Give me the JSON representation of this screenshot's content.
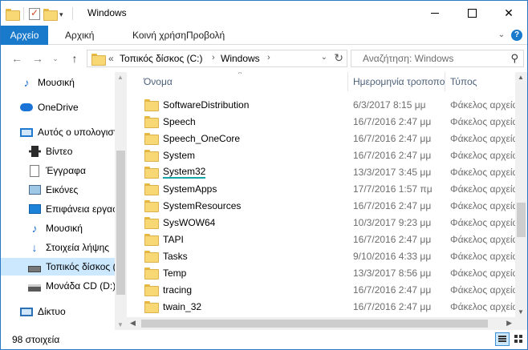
{
  "window": {
    "title": "Windows"
  },
  "ribbon": {
    "file_tab": "Αρχείο",
    "tabs": [
      "Αρχική",
      "Κοινή χρήση",
      "Προβολή"
    ]
  },
  "address": {
    "overflow": "«",
    "crumbs": [
      "Τοπικός δίσκος (C:)",
      "Windows"
    ]
  },
  "search": {
    "placeholder": "Αναζήτηση: Windows"
  },
  "nav": {
    "items": [
      {
        "label": "Μουσική",
        "icon": "music-note-icon"
      },
      {
        "label": "OneDrive",
        "icon": "cloud-icon"
      },
      {
        "label": "Αυτός ο υπολογιστής",
        "icon": "computer-icon"
      },
      {
        "label": "Βίντεο",
        "icon": "video-icon"
      },
      {
        "label": "Έγγραφα",
        "icon": "documents-icon"
      },
      {
        "label": "Εικόνες",
        "icon": "pictures-icon"
      },
      {
        "label": "Επιφάνεια εργασίας",
        "icon": "desktop-icon"
      },
      {
        "label": "Μουσική",
        "icon": "music-note-icon"
      },
      {
        "label": "Στοιχεία λήψης",
        "icon": "download-arrow-icon"
      },
      {
        "label": "Τοπικός δίσκος (C:)",
        "icon": "local-disk-icon"
      },
      {
        "label": "Μονάδα CD (D:)",
        "icon": "cd-drive-icon"
      },
      {
        "label": "Δίκτυο",
        "icon": "network-icon"
      }
    ]
  },
  "columns": {
    "name": "Όνομα",
    "date": "Ημερομηνία τροποποίησης",
    "type": "Τύπος"
  },
  "files": [
    {
      "name": "SoftwareDistribution",
      "date": "6/3/2017 8:15 μμ",
      "type": "Φάκελος αρχείων"
    },
    {
      "name": "Speech",
      "date": "16/7/2016 2:47 μμ",
      "type": "Φάκελος αρχείων"
    },
    {
      "name": "Speech_OneCore",
      "date": "16/7/2016 2:47 μμ",
      "type": "Φάκελος αρχείων"
    },
    {
      "name": "System",
      "date": "16/7/2016 2:47 μμ",
      "type": "Φάκελος αρχείων"
    },
    {
      "name": "System32",
      "date": "13/3/2017 3:45 μμ",
      "type": "Φάκελος αρχείων"
    },
    {
      "name": "SystemApps",
      "date": "17/7/2016 1:57 πμ",
      "type": "Φάκελος αρχείων"
    },
    {
      "name": "SystemResources",
      "date": "16/7/2016 2:47 μμ",
      "type": "Φάκελος αρχείων"
    },
    {
      "name": "SysWOW64",
      "date": "10/3/2017 9:23 μμ",
      "type": "Φάκελος αρχείων"
    },
    {
      "name": "TAPI",
      "date": "16/7/2016 2:47 μμ",
      "type": "Φάκελος αρχείων"
    },
    {
      "name": "Tasks",
      "date": "9/10/2016 4:33 μμ",
      "type": "Φάκελος αρχείων"
    },
    {
      "name": "Temp",
      "date": "13/3/2017 8:56 μμ",
      "type": "Φάκελος αρχείων"
    },
    {
      "name": "tracing",
      "date": "16/7/2016 2:47 μμ",
      "type": "Φάκελος αρχείων"
    },
    {
      "name": "twain_32",
      "date": "16/7/2016 2:47 μμ",
      "type": "Φάκελος αρχείων"
    }
  ],
  "status": {
    "count": "98 στοιχεία"
  },
  "colors": {
    "accent": "#1979ca",
    "selection": "#cce8ff",
    "highlight_underline": "#15a5a8"
  }
}
